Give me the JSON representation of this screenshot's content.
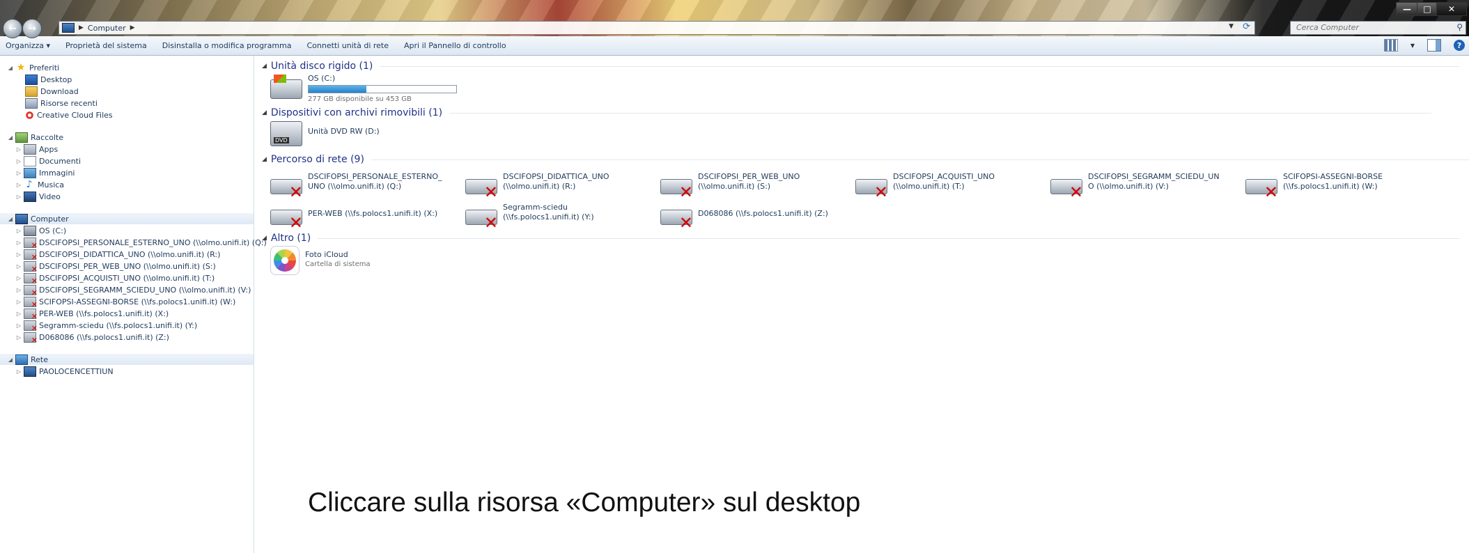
{
  "window": {
    "address": {
      "crumbs": [
        "Computer"
      ]
    },
    "search": {
      "placeholder": "Cerca Computer"
    }
  },
  "toolbar": {
    "organize": "Organizza ▾",
    "items": [
      "Proprietà del sistema",
      "Disinstalla o modifica programma",
      "Connetti unità di rete",
      "Apri il Pannello di controllo"
    ]
  },
  "navpane": {
    "favorites": {
      "label": "Preferiti",
      "items": [
        "Desktop",
        "Download",
        "Risorse recenti",
        "Creative Cloud Files"
      ]
    },
    "libraries": {
      "label": "Raccolte",
      "items": [
        "Apps",
        "Documenti",
        "Immagini",
        "Musica",
        "Video"
      ]
    },
    "computer": {
      "label": "Computer",
      "items": [
        "OS (C:)",
        "DSCIFOPSI_PERSONALE_ESTERNO_UNO (\\\\olmo.unifi.it) (Q:)",
        "DSCIFOPSI_DIDATTICA_UNO (\\\\olmo.unifi.it) (R:)",
        "DSCIFOPSI_PER_WEB_UNO (\\\\olmo.unifi.it) (S:)",
        "DSCIFOPSI_ACQUISTI_UNO (\\\\olmo.unifi.it) (T:)",
        "DSCIFOPSI_SEGRAMM_SCIEDU_UNO (\\\\olmo.unifi.it) (V:)",
        "SCIFOPSI-ASSEGNI-BORSE (\\\\fs.polocs1.unifi.it) (W:)",
        "PER-WEB (\\\\fs.polocs1.unifi.it) (X:)",
        "Segramm-sciedu (\\\\fs.polocs1.unifi.it) (Y:)",
        "D068086 (\\\\fs.polocs1.unifi.it) (Z:)"
      ]
    },
    "network": {
      "label": "Rete",
      "items": [
        "PAOLOCENCETTIUN"
      ]
    }
  },
  "content": {
    "hdd_group": "Unità disco rigido (1)",
    "hdd": {
      "name": "OS (C:)",
      "free_text": "277 GB disponibile su 453 GB",
      "used_fraction": 0.39
    },
    "removable_group": "Dispositivi con archivi rimovibili (1)",
    "dvd": {
      "name": "Unità DVD RW (D:)"
    },
    "network_group": "Percorso di rete (9)",
    "network_drives": [
      {
        "line1": "DSCIFOPSI_PERSONALE_ESTERNO_",
        "line2": "UNO (\\\\olmo.unifi.it) (Q:)"
      },
      {
        "line1": "DSCIFOPSI_DIDATTICA_UNO",
        "line2": "(\\\\olmo.unifi.it) (R:)"
      },
      {
        "line1": "DSCIFOPSI_PER_WEB_UNO",
        "line2": "(\\\\olmo.unifi.it) (S:)"
      },
      {
        "line1": "DSCIFOPSI_ACQUISTI_UNO",
        "line2": "(\\\\olmo.unifi.it) (T:)"
      },
      {
        "line1": "DSCIFOPSI_SEGRAMM_SCIEDU_UN",
        "line2": "O (\\\\olmo.unifi.it) (V:)"
      },
      {
        "line1": "SCIFOPSI-ASSEGNI-BORSE",
        "line2": "(\\\\fs.polocs1.unifi.it) (W:)"
      },
      {
        "line1": "PER-WEB (\\\\fs.polocs1.unifi.it) (X:)",
        "line2": ""
      },
      {
        "line1": "Segramm-sciedu",
        "line2": "(\\\\fs.polocs1.unifi.it) (Y:)"
      },
      {
        "line1": "D068086 (\\\\fs.polocs1.unifi.it) (Z:)",
        "line2": ""
      }
    ],
    "other_group": "Altro (1)",
    "icloud": {
      "name": "Foto iCloud",
      "sub": "Cartella di sistema"
    }
  },
  "caption": "Cliccare sulla risorsa «Computer» sul desktop"
}
